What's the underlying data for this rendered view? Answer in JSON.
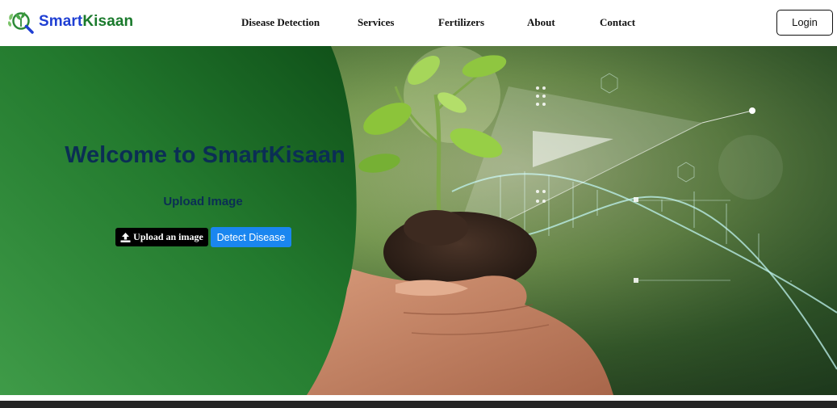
{
  "header": {
    "brand_part1": "Smart",
    "brand_part2": "Kisaan",
    "nav": [
      {
        "label": "Disease Detection"
      },
      {
        "label": "Services"
      },
      {
        "label": "Fertilizers"
      },
      {
        "label": "About"
      },
      {
        "label": "Contact"
      }
    ],
    "login_label": "Login"
  },
  "hero": {
    "title": "Welcome to SmartKisaan",
    "upload_heading": "Upload Image",
    "upload_button_label": "Upload an image",
    "detect_button_label": "Detect Disease"
  },
  "colors": {
    "brand_blue": "#1f3fd3",
    "brand_green": "#1a7a2c",
    "title_navy": "#0b2e54",
    "panel_green": "#1f6a2a",
    "detect_blue": "#1a86f0"
  },
  "icons": {
    "logo": "plant-magnifier-icon",
    "upload": "upload-arrow-icon"
  }
}
